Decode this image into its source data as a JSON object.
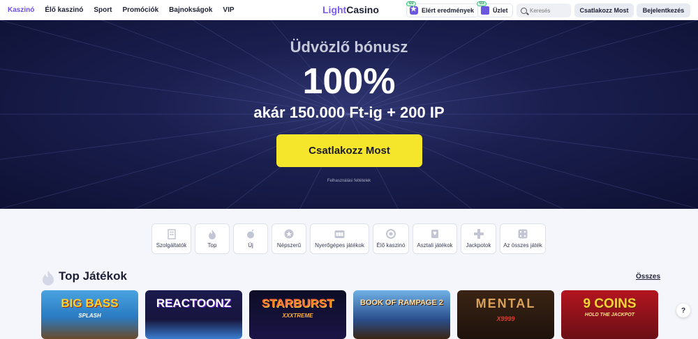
{
  "nav": {
    "items": [
      "Kaszinó",
      "Élő kaszinó",
      "Sport",
      "Promóciók",
      "Bajnokságok",
      "VIP"
    ]
  },
  "logo": {
    "part1": "Light",
    "part2": "Casino"
  },
  "header": {
    "achievements_label": "Elért eredmények",
    "shop_label": "Üzlet",
    "new_badge": "ÚJ",
    "search_placeholder": "Keresés",
    "join_label": "Csatlakozz Most",
    "login_label": "Bejelentkezés"
  },
  "hero": {
    "subtitle": "Üdvözlő bónusz",
    "headline": "100%",
    "offer": "akár 150.000 Ft-ig + 200 IP",
    "cta": "Csatlakozz Most",
    "terms": "Felhasználási feltételek"
  },
  "categories": [
    {
      "label": "Szolgáltatók",
      "icon": "building-icon"
    },
    {
      "label": "Top",
      "icon": "flame-icon"
    },
    {
      "label": "Új",
      "icon": "bomb-icon"
    },
    {
      "label": "Népszerű",
      "icon": "star-icon"
    },
    {
      "label": "Nyerőgépes játékok",
      "icon": "slot-icon"
    },
    {
      "label": "Élő kaszinó",
      "icon": "roulette-icon"
    },
    {
      "label": "Asztali játékok",
      "icon": "cards-icon"
    },
    {
      "label": "Jackpotok",
      "icon": "clover-icon"
    },
    {
      "label": "Az összes játék",
      "icon": "dice-icon"
    }
  ],
  "top_games": {
    "title": "Top Játékok",
    "all_link": "Összes",
    "games": [
      {
        "title": "BIG BASS",
        "subtitle": "SPLASH",
        "bg": "#2a7bc2"
      },
      {
        "title": "REACTOONZ",
        "subtitle": "",
        "bg": "#17153d"
      },
      {
        "title": "STARBURST",
        "subtitle": "XXXTREME",
        "bg": "#0f0f2a"
      },
      {
        "title": "BOOK OF RAMPAGE 2",
        "subtitle": "",
        "bg": "#2a4e8c"
      },
      {
        "title": "MENTAL",
        "subtitle": "X9999",
        "bg": "#1e120c"
      },
      {
        "title": "9 COINS",
        "subtitle": "HOLD THE JACKPOT",
        "bg": "#6b0f16"
      }
    ]
  },
  "help_label": "?"
}
